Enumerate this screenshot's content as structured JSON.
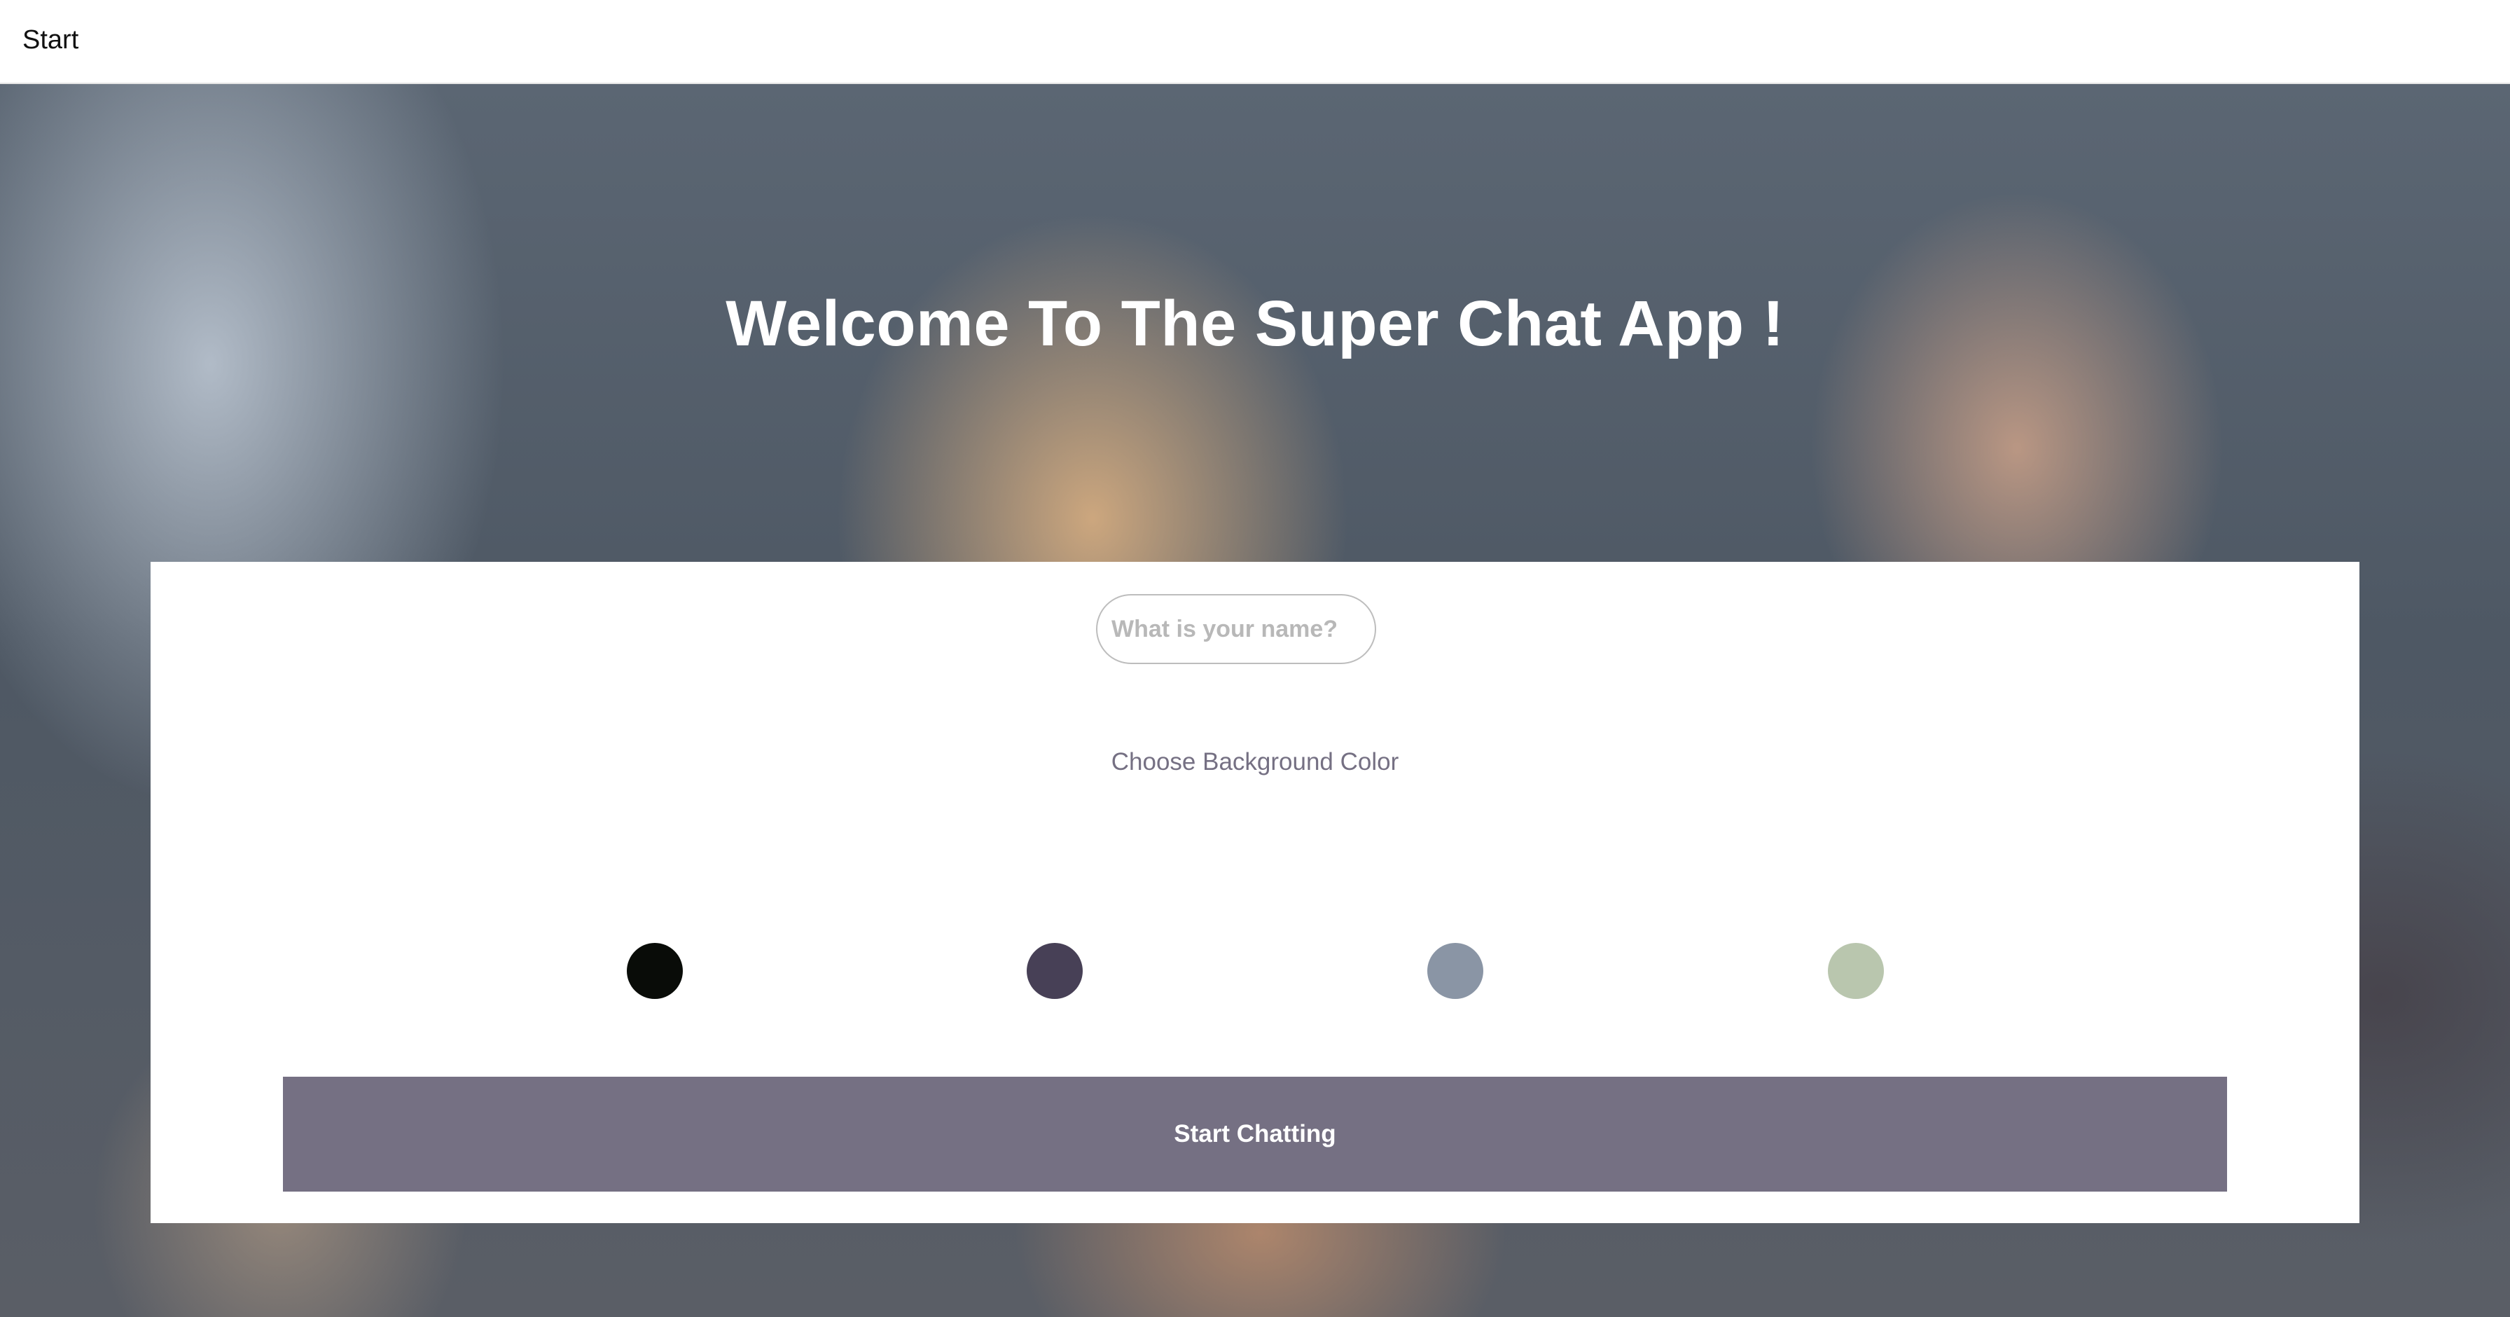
{
  "nav": {
    "title": "Start"
  },
  "hero": {
    "title": "Welcome To The Super Chat App !"
  },
  "form": {
    "name_placeholder": "What is your name?",
    "name_value": "",
    "color_label": "Choose Background Color",
    "colors": [
      "#090C08",
      "#474056",
      "#8A95A5",
      "#B9C6AE"
    ],
    "start_button_label": "Start Chatting",
    "button_color": "#757083"
  }
}
